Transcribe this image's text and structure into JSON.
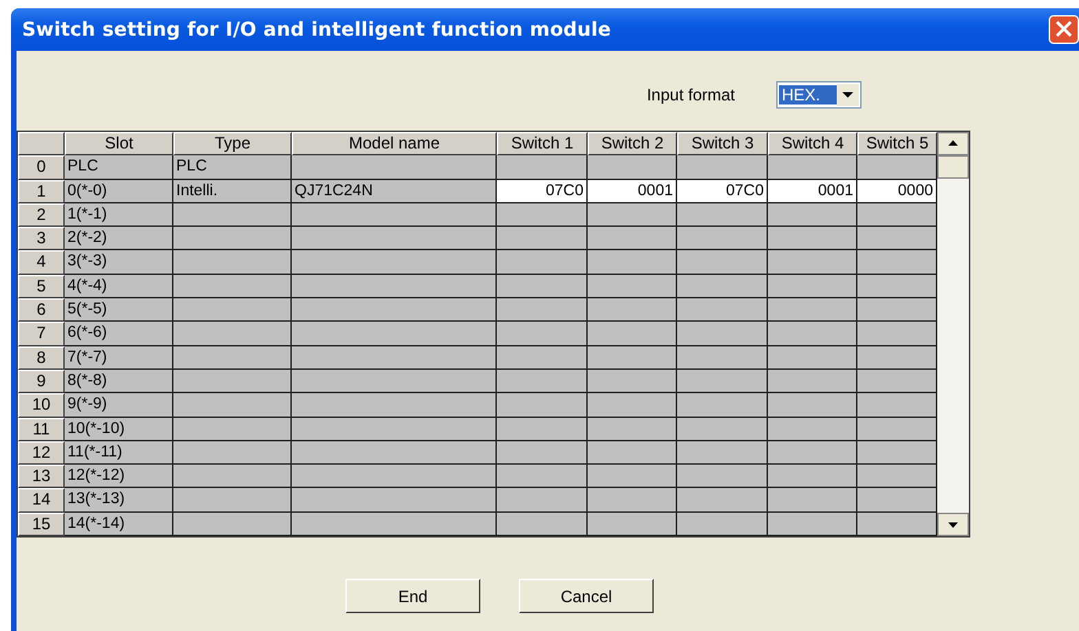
{
  "window": {
    "title": "Switch setting for I/O and intelligent function module"
  },
  "input_format": {
    "label": "Input format",
    "value": "HEX."
  },
  "table": {
    "columns": [
      "Slot",
      "Type",
      "Model name",
      "Switch 1",
      "Switch 2",
      "Switch 3",
      "Switch 4",
      "Switch 5"
    ],
    "rows": [
      {
        "number": "0",
        "slot": "PLC",
        "type": "PLC",
        "editable": false
      },
      {
        "number": "1",
        "slot": "0(*-0)",
        "type": "Intelli.",
        "model": "QJ71C24N",
        "editable": true,
        "switches": [
          "07C0",
          "0001",
          "07C0",
          "0001",
          "0000"
        ]
      },
      {
        "number": "2",
        "slot": "1(*-1)",
        "editable": false
      },
      {
        "number": "3",
        "slot": "2(*-2)",
        "editable": false
      },
      {
        "number": "4",
        "slot": "3(*-3)",
        "editable": false
      },
      {
        "number": "5",
        "slot": "4(*-4)",
        "editable": false
      },
      {
        "number": "6",
        "slot": "5(*-5)",
        "editable": false
      },
      {
        "number": "7",
        "slot": "6(*-6)",
        "editable": false
      },
      {
        "number": "8",
        "slot": "7(*-7)",
        "editable": false
      },
      {
        "number": "9",
        "slot": "8(*-8)",
        "editable": false
      },
      {
        "number": "10",
        "slot": "9(*-9)",
        "editable": false
      },
      {
        "number": "11",
        "slot": "10(*-10)",
        "editable": false
      },
      {
        "number": "12",
        "slot": "11(*-11)",
        "editable": false
      },
      {
        "number": "13",
        "slot": "12(*-12)",
        "editable": false
      },
      {
        "number": "14",
        "slot": "13(*-13)",
        "editable": false
      },
      {
        "number": "15",
        "slot": "14(*-14)",
        "editable": false
      }
    ]
  },
  "buttons": [
    "End",
    "Cancel"
  ]
}
